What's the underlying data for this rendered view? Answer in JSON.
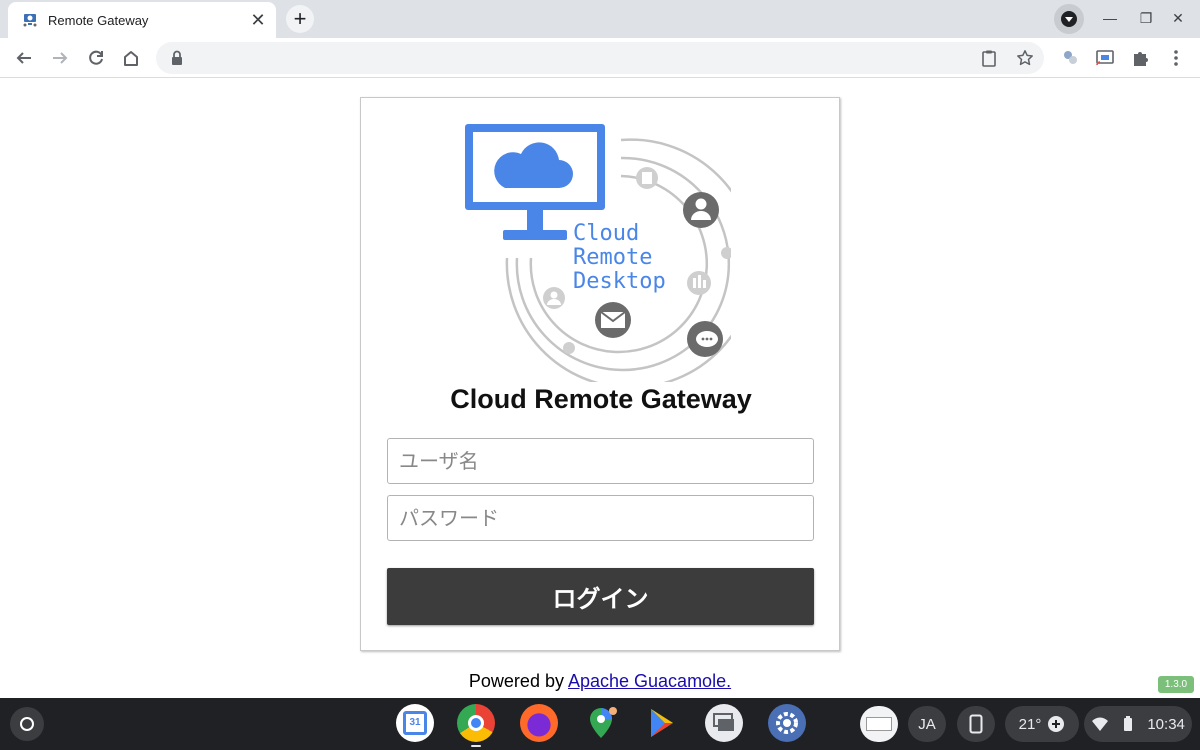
{
  "browser": {
    "tab_title": "Remote Gateway",
    "tab_close": "✕",
    "new_tab": "+",
    "win_minimize": "—",
    "win_restore": "❐",
    "win_close": "✕"
  },
  "logo": {
    "line1": "Cloud",
    "line2": "Remote",
    "line3": "Desktop"
  },
  "login": {
    "title": "Cloud Remote Gateway",
    "username_placeholder": "ユーザ名",
    "password_placeholder": "パスワード",
    "submit_label": "ログイン"
  },
  "footer": {
    "powered_prefix": "Powered by",
    "powered_link": "Apache Guacamole.",
    "version": "1.3.0"
  },
  "shelf": {
    "calendar_day": "31",
    "ime_label": "JA",
    "temperature": "21°",
    "clock": "10:34"
  },
  "colors": {
    "accent_blue": "#4a86e8",
    "button_dark": "#3c3c3c",
    "shelf_bg": "#202124"
  }
}
